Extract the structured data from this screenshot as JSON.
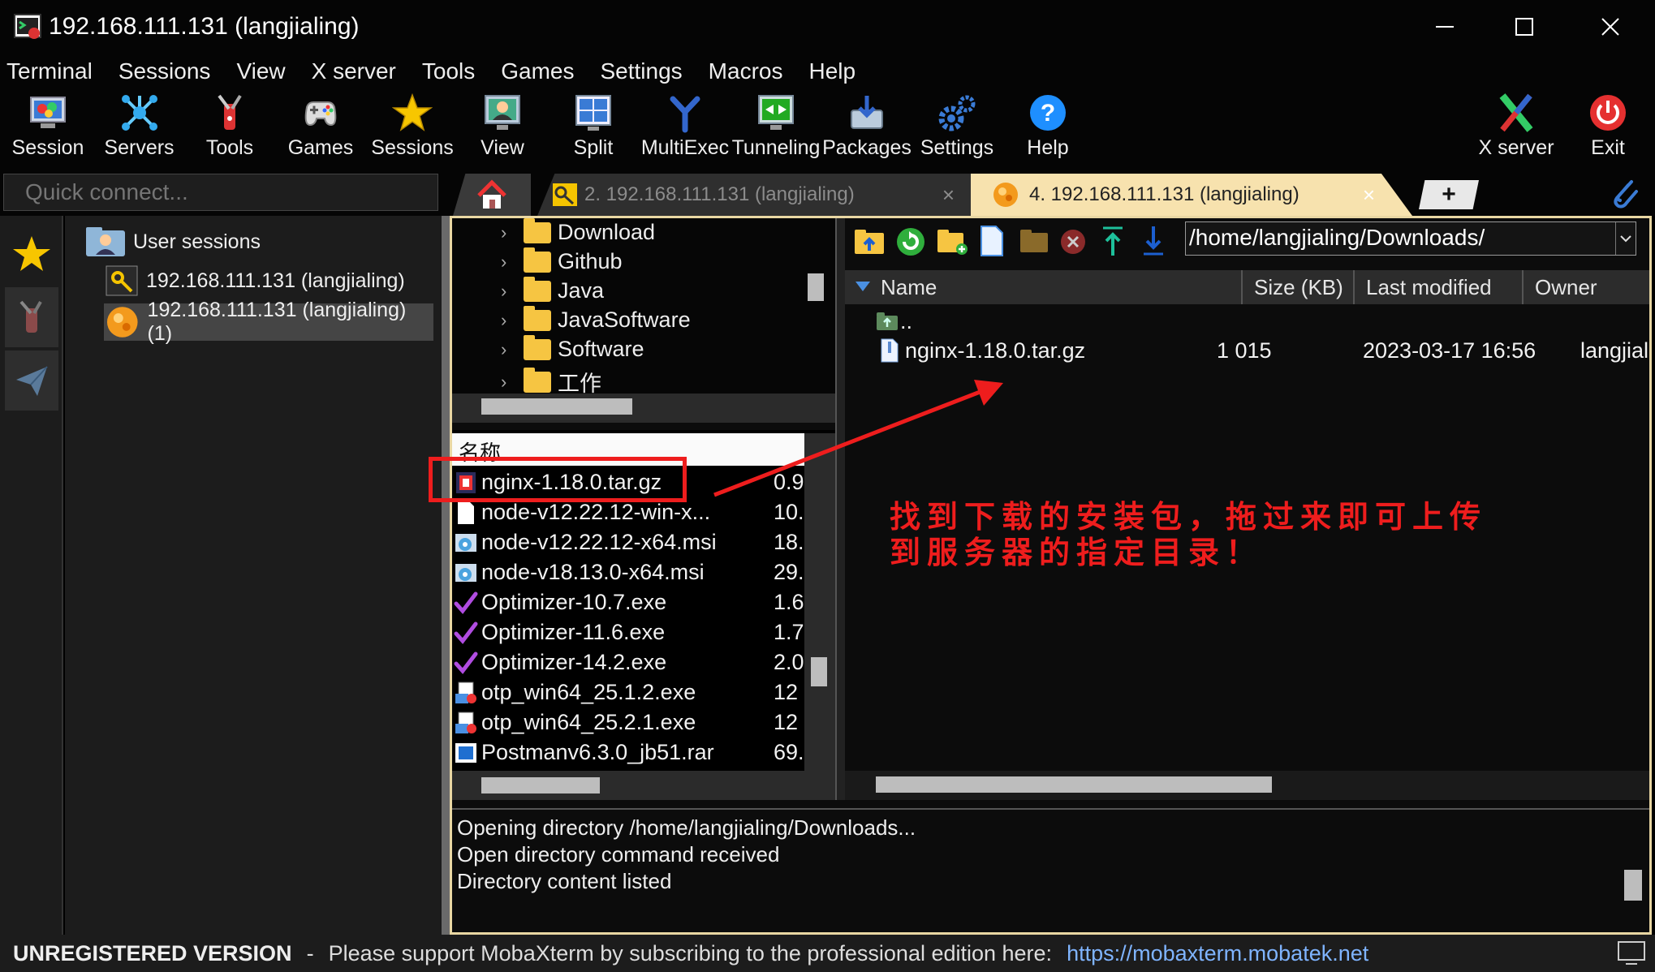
{
  "window": {
    "title": "192.168.111.131 (langjialing)"
  },
  "menu": [
    "Terminal",
    "Sessions",
    "View",
    "X server",
    "Tools",
    "Games",
    "Settings",
    "Macros",
    "Help"
  ],
  "toolbar": {
    "session": "Session",
    "servers": "Servers",
    "tools": "Tools",
    "games": "Games",
    "sessions": "Sessions",
    "view": "View",
    "split": "Split",
    "multiexec": "MultiExec",
    "tunneling": "Tunneling",
    "packages": "Packages",
    "settings": "Settings",
    "help": "Help",
    "xserver": "X server",
    "exit": "Exit"
  },
  "quick_connect": {
    "placeholder": "Quick connect..."
  },
  "tabs": {
    "tab2": "2. 192.168.111.131 (langjialing)",
    "tab4": "4. 192.168.111.131 (langjialing)",
    "close": "×",
    "new": "+"
  },
  "sessions": {
    "root": "User sessions",
    "items": [
      "192.168.111.131 (langjialing)",
      "192.168.111.131 (langjialing) (1)"
    ]
  },
  "local_tree": [
    "Download",
    "Github",
    "Java",
    "JavaSoftware",
    "Software",
    "工作"
  ],
  "local_list": {
    "header": "名称",
    "rows": [
      {
        "name": "nginx-1.18.0.tar.gz",
        "size": "0.9"
      },
      {
        "name": "node-v12.22.12-win-x...",
        "size": "10."
      },
      {
        "name": "node-v12.22.12-x64.msi",
        "size": "18."
      },
      {
        "name": "node-v18.13.0-x64.msi",
        "size": "29."
      },
      {
        "name": "Optimizer-10.7.exe",
        "size": "1.6"
      },
      {
        "name": "Optimizer-11.6.exe",
        "size": "1.7"
      },
      {
        "name": "Optimizer-14.2.exe",
        "size": "2.0"
      },
      {
        "name": "otp_win64_25.1.2.exe",
        "size": "12"
      },
      {
        "name": "otp_win64_25.2.1.exe",
        "size": "12"
      },
      {
        "name": "Postmanv6.3.0_jb51.rar",
        "size": "69."
      }
    ]
  },
  "remote": {
    "path": "/home/langjialing/Downloads/",
    "columns": {
      "name": "Name",
      "size": "Size (KB)",
      "modified": "Last modified",
      "owner": "Owner"
    },
    "parent": "..",
    "rows": [
      {
        "name": "nginx-1.18.0.tar.gz",
        "size": "1 015",
        "modified": "2023-03-17 16:56",
        "owner": "langjial"
      }
    ]
  },
  "log": [
    "Opening directory /home/langjialing/Downloads...",
    "Open directory command received",
    "Directory content listed"
  ],
  "status": {
    "unregistered": "UNREGISTERED VERSION",
    "separator": "-",
    "message": "Please support MobaXterm by subscribing to the professional edition here:",
    "link": "https://mobaxterm.mobatek.net"
  },
  "annotation": {
    "text": "找到下载的安装包，拖过来即可上传到服务器的指定目录！",
    "color": "#ee1d1d"
  },
  "colors": {
    "accent": "#e9d7a3",
    "annotation": "#ee1d1d",
    "folder": "#f6c542",
    "link": "#7fb4ff"
  }
}
